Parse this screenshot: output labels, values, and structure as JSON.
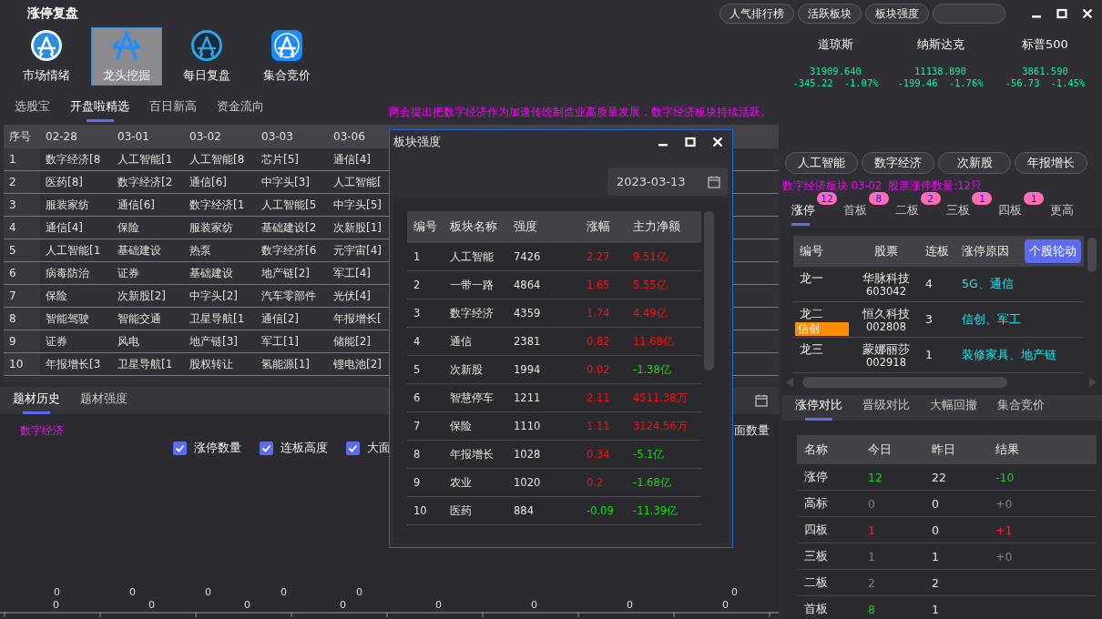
{
  "window": {
    "title": "涨停复盘"
  },
  "top_buttons": [
    "人气排行榜",
    "活跃板块",
    "板块强度"
  ],
  "nav": [
    {
      "label": "市场情绪",
      "kind": "disc",
      "selected": false
    },
    {
      "label": "龙头挖掘",
      "kind": "bare",
      "selected": true
    },
    {
      "label": "每日复盘",
      "kind": "ring",
      "selected": false
    },
    {
      "label": "集合竞价",
      "kind": "tile",
      "selected": false
    }
  ],
  "indices": [
    {
      "name": "道琼斯",
      "value": "31909.640",
      "change": "-345.22",
      "percent": "-1.07%"
    },
    {
      "name": "纳斯达克",
      "value": "11138.890",
      "change": "-199.46",
      "percent": "-1.76%"
    },
    {
      "name": "标普500",
      "value": "3861.590",
      "change": "-56.73",
      "percent": "-1.45%"
    }
  ],
  "subtabs": [
    {
      "label": "选股宝",
      "selected": false
    },
    {
      "label": "开盘啦精选",
      "selected": true
    },
    {
      "label": "百日新高",
      "selected": false
    },
    {
      "label": "资金流向",
      "selected": false
    }
  ],
  "ticker": "两会提出把数字经济作为加速传统制造业高质量发展，数字经济板块持续活跃。",
  "rank_table": {
    "columns": [
      "序号",
      "02-28",
      "03-01",
      "03-02",
      "03-03",
      "03-06"
    ],
    "rows": [
      [
        "1",
        "数字经济[8",
        "人工智能[1",
        "人工智能[8",
        "芯片[5]",
        "通信[4]"
      ],
      [
        "2",
        "医药[8]",
        "数字经济[2",
        "通信[6]",
        "中字头[3]",
        "人工智能["
      ],
      [
        "3",
        "服装家纺",
        "通信[6]",
        "数字经济[1",
        "人工智能[5",
        "中字头[5]"
      ],
      [
        "4",
        "通信[4]",
        "保险",
        "服装家纺",
        "基础建设[2",
        "次新股[1]"
      ],
      [
        "5",
        "人工智能[1",
        "基础建设",
        "热泵",
        "数字经济[6",
        "元宇宙[4]"
      ],
      [
        "6",
        "病毒防治",
        "证券",
        "基础建设",
        "地产链[2]",
        "军工[4]"
      ],
      [
        "7",
        "保险",
        "次新股[2]",
        "中字头[2]",
        "汽车零部件",
        "光伏[4]"
      ],
      [
        "8",
        "智能驾驶",
        "智能交通",
        "卫星导航[1",
        "通信[2]",
        "年报增长["
      ],
      [
        "9",
        "证券",
        "风电",
        "地产链[3]",
        "军工[1]",
        "储能[2]"
      ],
      [
        "10",
        "年报增长[3",
        "卫星导航[1",
        "股权转让",
        "氢能源[1]",
        "锂电池[2]"
      ]
    ]
  },
  "theme_panel": {
    "tabs": [
      {
        "label": "题材历史",
        "selected": true
      },
      {
        "label": "题材强度",
        "selected": false
      }
    ],
    "theme": "数字经济",
    "legend_label": "面数量",
    "checkboxes": [
      {
        "label": "涨停数量",
        "checked": true
      },
      {
        "label": "连板高度",
        "checked": true
      },
      {
        "label": "大面",
        "checked": true
      }
    ],
    "upper_labels": [
      "0",
      "0",
      "0",
      "0",
      "0",
      "0"
    ],
    "lower_labels": [
      "0",
      "0",
      "0",
      "0",
      "0",
      "0",
      "0",
      "0"
    ]
  },
  "strength_dialog": {
    "title": "板块强度",
    "date": "2023-03-13",
    "columns": [
      "编号",
      "板块名称",
      "强度",
      "涨幅",
      "主力净额"
    ],
    "rows": [
      {
        "no": "1",
        "name": "人工智能",
        "strength": "7426",
        "change": {
          "text": "2.27",
          "color": "#ff1010"
        },
        "net": {
          "text": "9.51亿",
          "color": "#ff1010"
        }
      },
      {
        "no": "2",
        "name": "一带一路",
        "strength": "4864",
        "change": {
          "text": "1.65",
          "color": "#ff1010"
        },
        "net": {
          "text": "5.55亿",
          "color": "#ff1010"
        }
      },
      {
        "no": "3",
        "name": "数字经济",
        "strength": "4359",
        "change": {
          "text": "1.74",
          "color": "#ff1010"
        },
        "net": {
          "text": "4.49亿",
          "color": "#ff1010"
        }
      },
      {
        "no": "4",
        "name": "通信",
        "strength": "2381",
        "change": {
          "text": "0.82",
          "color": "#ff1010"
        },
        "net": {
          "text": "11.68亿",
          "color": "#ff1010"
        }
      },
      {
        "no": "5",
        "name": "次新股",
        "strength": "1994",
        "change": {
          "text": "0.02",
          "color": "#ff1010"
        },
        "net": {
          "text": "-1.38亿",
          "color": "#10e010"
        }
      },
      {
        "no": "6",
        "name": "智慧停车",
        "strength": "1211",
        "change": {
          "text": "2.11",
          "color": "#ff1010"
        },
        "net": {
          "text": "4511.38万",
          "color": "#ff1010"
        }
      },
      {
        "no": "7",
        "name": "保险",
        "strength": "1110",
        "change": {
          "text": "1.11",
          "color": "#ff1010"
        },
        "net": {
          "text": "3124.56万",
          "color": "#ff1010"
        }
      },
      {
        "no": "8",
        "name": "年报增长",
        "strength": "1028",
        "change": {
          "text": "0.34",
          "color": "#ff1010"
        },
        "net": {
          "text": "-5.1亿",
          "color": "#10e010"
        }
      },
      {
        "no": "9",
        "name": "农业",
        "strength": "1020",
        "change": {
          "text": "0.2",
          "color": "#ff1010"
        },
        "net": {
          "text": "-1.68亿",
          "color": "#10e010"
        }
      },
      {
        "no": "10",
        "name": "医药",
        "strength": "884",
        "change": {
          "text": "-0.09",
          "color": "#10e010"
        },
        "net": {
          "text": "-11.39亿",
          "color": "#10e010"
        }
      }
    ]
  },
  "sector_tags": [
    "人工智能",
    "数字经济",
    "次新股",
    "年报增长"
  ],
  "sector_info": "数字经济板块 03-02  股票涨停数量:12只",
  "board_tabs": [
    {
      "label": "涨停",
      "badge": "12",
      "selected": true
    },
    {
      "label": "首板",
      "badge": "8",
      "selected": false
    },
    {
      "label": "二板",
      "badge": "2",
      "selected": false
    },
    {
      "label": "三板",
      "badge": "1",
      "selected": false
    },
    {
      "label": "四板",
      "badge": "1",
      "selected": false
    },
    {
      "label": "更高",
      "selected": false
    }
  ],
  "limit_table": {
    "columns": [
      "编号",
      "股票",
      "连板",
      "涨停原因"
    ],
    "action_button": "个股轮动",
    "rows": [
      {
        "rank": "龙一",
        "name": "华脉科技",
        "code": "603042",
        "boards": "4",
        "reason": "5G、通信"
      },
      {
        "rank": "龙二",
        "tag": "信创",
        "name": "恒久科技",
        "code": "002808",
        "boards": "3",
        "reason": "信创、军工"
      },
      {
        "rank": "龙三",
        "name": "蒙娜丽莎",
        "code": "002918",
        "boards": "1",
        "reason": "装修家具、地产链"
      }
    ]
  },
  "compare_panel": {
    "tabs": [
      {
        "label": "涨停对比",
        "selected": true
      },
      {
        "label": "晋级对比",
        "selected": false
      },
      {
        "label": "大幅回撤",
        "selected": false
      },
      {
        "label": "集合竞价",
        "selected": false
      }
    ],
    "columns": [
      "名称",
      "今日",
      "昨日",
      "结果"
    ],
    "rows": [
      {
        "name": "涨停",
        "today": {
          "text": "12",
          "color": "#19d219"
        },
        "yesterday": "22",
        "result": {
          "text": "-10",
          "color": "#19d219"
        }
      },
      {
        "name": "高标",
        "today": {
          "text": "0",
          "color": "#808080"
        },
        "yesterday": "0",
        "result": {
          "text": "+0",
          "color": "#808080"
        }
      },
      {
        "name": "四板",
        "today": {
          "text": "1",
          "color": "#ff2020"
        },
        "yesterday": "0",
        "result": {
          "text": "+1",
          "color": "#ff2020"
        }
      },
      {
        "name": "三板",
        "today": {
          "text": "1",
          "color": "#808080"
        },
        "yesterday": "1",
        "result": {
          "text": "+0",
          "color": "#808080"
        }
      },
      {
        "name": "二板",
        "today": {
          "text": "2",
          "color": "#808080"
        },
        "yesterday": "2"
      },
      {
        "name": "首板",
        "today": {
          "text": "8",
          "color": "#19d219"
        },
        "yesterday": "1"
      }
    ]
  }
}
